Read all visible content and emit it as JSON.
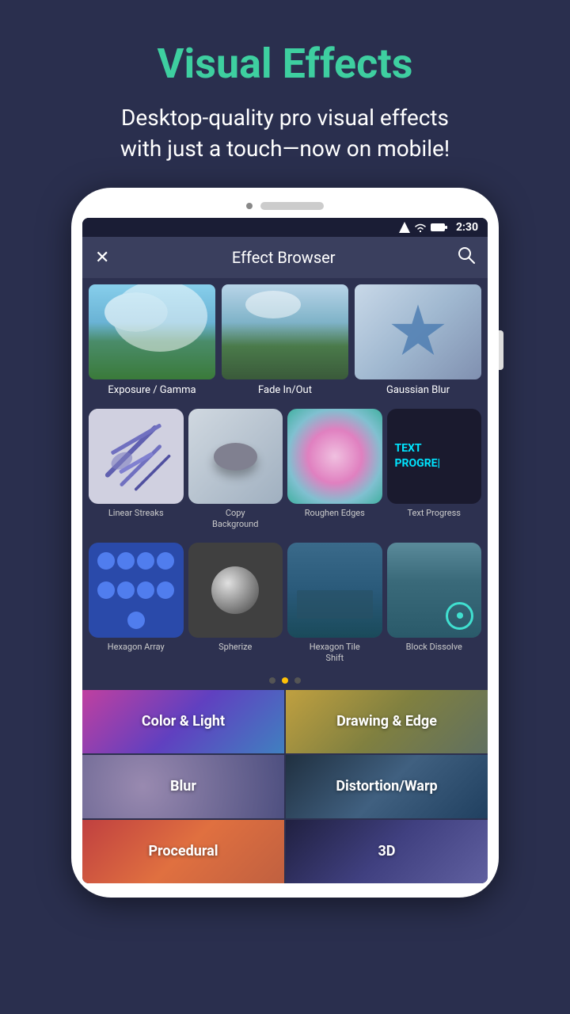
{
  "page": {
    "title": "Visual Effects",
    "subtitle": "Desktop-quality pro visual effects\nwith just a touch—now on mobile!",
    "title_color": "#3ecfa0"
  },
  "status_bar": {
    "time": "2:30"
  },
  "app_bar": {
    "title": "Effect Browser",
    "close_label": "✕",
    "search_label": "🔍"
  },
  "top_effects": [
    {
      "label": "Exposure / Gamma",
      "type": "exposure"
    },
    {
      "label": "Fade In/Out",
      "type": "fade"
    },
    {
      "label": "Gaussian Blur",
      "type": "gaussian"
    }
  ],
  "grid_effects_row1": [
    {
      "label": "Linear Streaks",
      "type": "linear"
    },
    {
      "label": "Copy Background",
      "type": "copy-bg"
    },
    {
      "label": "Roughen Edges",
      "type": "roughen"
    },
    {
      "label": "Text Progress",
      "type": "text-progress"
    }
  ],
  "grid_effects_row2": [
    {
      "label": "Hexagon Array",
      "type": "hex-array"
    },
    {
      "label": "Spherize",
      "type": "spherize"
    },
    {
      "label": "Hexagon Tile Shift",
      "type": "hex-tile"
    },
    {
      "label": "Block Dissolve",
      "type": "block-dissolve"
    }
  ],
  "dots": [
    {
      "active": false
    },
    {
      "active": true
    },
    {
      "active": false
    }
  ],
  "categories": [
    {
      "label": "Color & Light",
      "type": "color-light"
    },
    {
      "label": "Drawing & Edge",
      "type": "drawing"
    },
    {
      "label": "Blur",
      "type": "blur"
    },
    {
      "label": "Distortion/Warp",
      "type": "distortion"
    },
    {
      "label": "Procedural",
      "type": "procedural"
    },
    {
      "label": "3D",
      "type": "3d"
    }
  ],
  "text_progress": {
    "line1": "TEXT",
    "line2": "PROGRE|"
  }
}
